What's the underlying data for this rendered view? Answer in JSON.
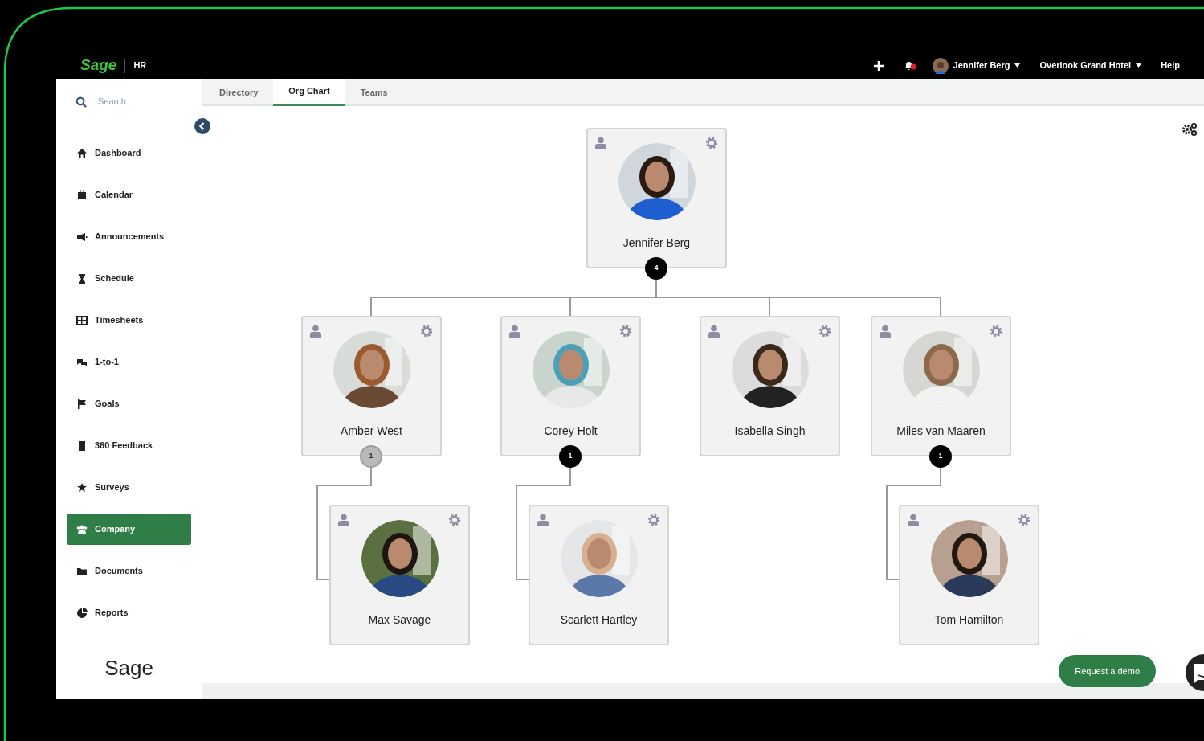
{
  "top_bar": {
    "logo": "Sage",
    "product": "HR",
    "notifications": true,
    "user": "Jennifer Berg",
    "company": "Overlook Grand Hotel",
    "help": "Help"
  },
  "sidebar": {
    "search": {
      "placeholder": "Search"
    },
    "items": [
      {
        "label": "Dashboard",
        "selected": false
      },
      {
        "label": "Calendar",
        "selected": false
      },
      {
        "label": "Announcements",
        "selected": false
      },
      {
        "label": "Schedule",
        "selected": false
      },
      {
        "label": "Timesheets",
        "selected": false
      },
      {
        "label": "1-to-1",
        "selected": false
      },
      {
        "label": "Goals",
        "selected": false
      },
      {
        "label": "360 Feedback",
        "selected": false
      },
      {
        "label": "Surveys",
        "selected": false
      },
      {
        "label": "Company",
        "selected": true
      },
      {
        "label": "Documents",
        "selected": false
      },
      {
        "label": "Reports",
        "selected": false
      }
    ],
    "footer_logo": "Sage"
  },
  "tabs": [
    {
      "label": "Directory",
      "selected": false
    },
    {
      "label": "Org Chart",
      "selected": true
    },
    {
      "label": "Teams",
      "selected": false
    }
  ],
  "org_chart": {
    "name": "Jennifer Berg",
    "reports": "4",
    "dimmed": false,
    "children": [
      {
        "name": "Amber West",
        "reports": "1",
        "dimmed": true,
        "children": [
          {
            "name": "Max Savage"
          }
        ]
      },
      {
        "name": "Corey Holt",
        "reports": "1",
        "dimmed": false,
        "children": [
          {
            "name": "Scarlett Hartley"
          }
        ]
      },
      {
        "name": "Isabella Singh"
      },
      {
        "name": "Miles van Maaren",
        "reports": "1",
        "dimmed": false,
        "children": [
          {
            "name": "Tom Hamilton"
          }
        ]
      }
    ]
  },
  "request_demo": "Request a demo"
}
